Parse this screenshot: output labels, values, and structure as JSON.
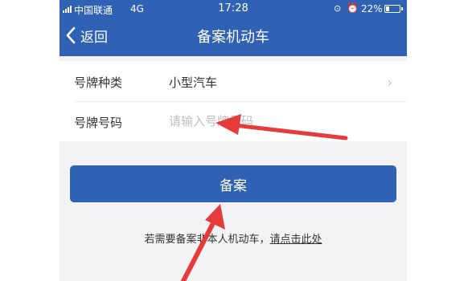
{
  "status_bar": {
    "carrier": "中国联通",
    "network": "4G",
    "time": "17:28",
    "battery": "22%",
    "icons": [
      "signal-icon",
      "rotation-lock-icon",
      "alarm-icon",
      "battery-icon"
    ]
  },
  "nav": {
    "back_label": "返回",
    "title": "备案机动车"
  },
  "form": {
    "plate_type_label": "号牌种类",
    "plate_type_value": "小型汽车",
    "plate_number_label": "号牌号码",
    "plate_number_placeholder": "请输入号牌号码",
    "plate_number_value": ""
  },
  "actions": {
    "submit_label": "备案"
  },
  "footer": {
    "note_text": "若需要备案非本人机动车，",
    "note_link": "请点击此处"
  },
  "colors": {
    "brand": "#2f61b5",
    "page_bg": "#f3f3f5",
    "annotation_arrow": "#e63b3b"
  }
}
